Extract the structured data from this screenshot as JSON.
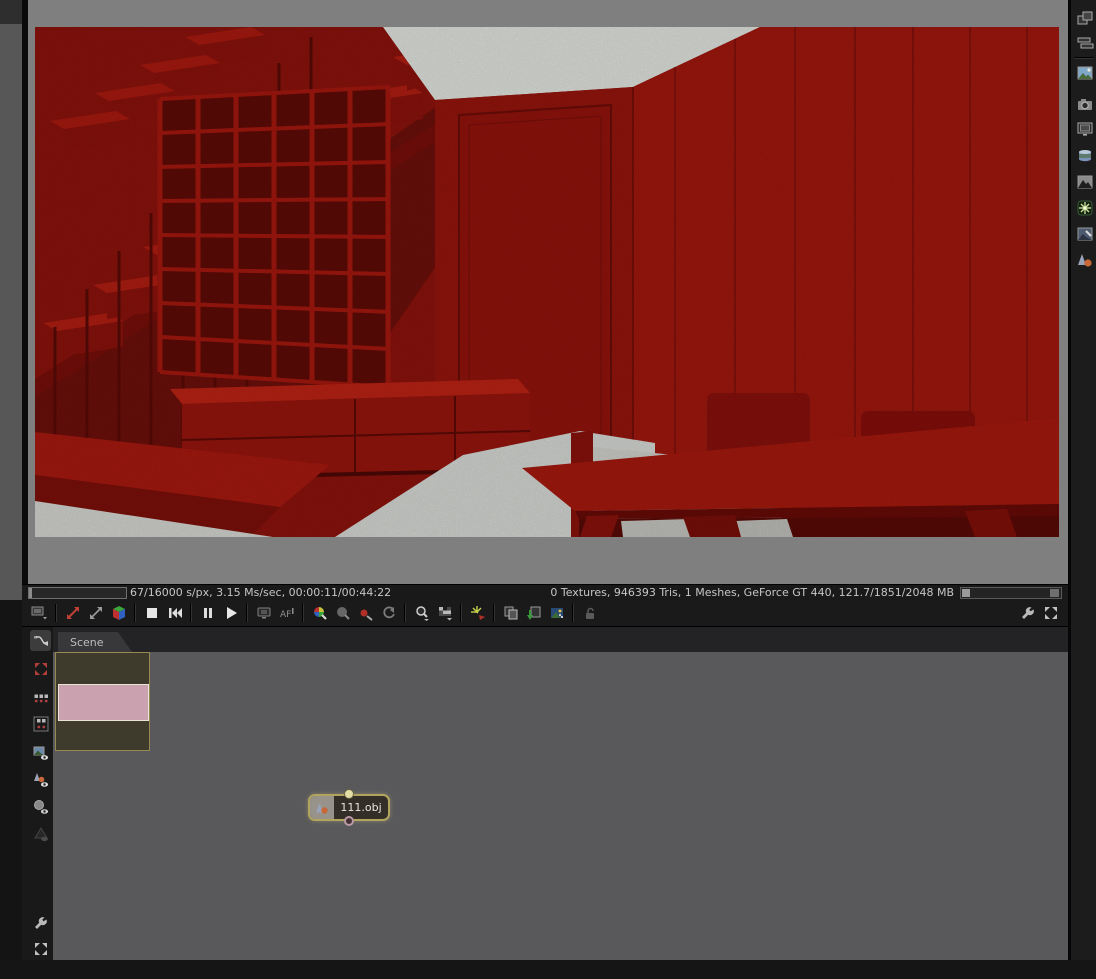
{
  "render_viewport": {
    "subject": "red interior scene: staircase, grid shelving, drawer cabinet, panel wall, table and chairs",
    "palette": {
      "wall_red": "#8f130d",
      "bright_red": "#b41e12",
      "shadow_red": "#70100b",
      "ceiling_white": "#e8eae5",
      "floor_white": "#dcdeda",
      "viewport_gray": "#7f7f7f"
    }
  },
  "status_bar": {
    "left_text": "67/16000 s/px, 3.15 Ms/sec, 00:00:11/00:44:22",
    "right_text": "0 Textures, 946393 Tris, 1 Meshes, GeForce GT 440, 121.7/1851/2048 MB",
    "progress_samples": "67/16000"
  },
  "render_toolbar": {
    "icons": [
      "viewport-display",
      "recenter-view",
      "actual-size",
      "rgb-channels",
      "stop-render",
      "restart-render",
      "pause-render",
      "start-render",
      "render-priority",
      "auto-focus",
      "white-balance-picker",
      "material-picker",
      "focus-picker",
      "object-picker",
      "zoom-region",
      "render-region",
      "film-sparkle",
      "copy-image",
      "paste-image",
      "save-image",
      "lock-viewport",
      "render-settings-wrench",
      "fullscreen-toggle"
    ]
  },
  "side_palette": {
    "icons": [
      "float-window",
      "layout-panels",
      "render-target",
      "camera",
      "display",
      "environment",
      "texture-image",
      "emitter",
      "imager",
      "material"
    ]
  },
  "node_editor": {
    "tab_label": "Scene",
    "toolbar_icons": [
      "connect-tool",
      "fit-graph",
      "layout-horizontal",
      "layout-vertical",
      "render-preview",
      "material-preview",
      "texture-preview",
      "mesh-preview",
      "editor-settings-wrench",
      "fit-view"
    ],
    "minimap": {
      "background": "#3e3b2c",
      "border": "#958a52",
      "view_rect_color": "#c9a1af"
    },
    "node": {
      "label": "111.obj",
      "type": "mesh",
      "selected": true
    }
  }
}
